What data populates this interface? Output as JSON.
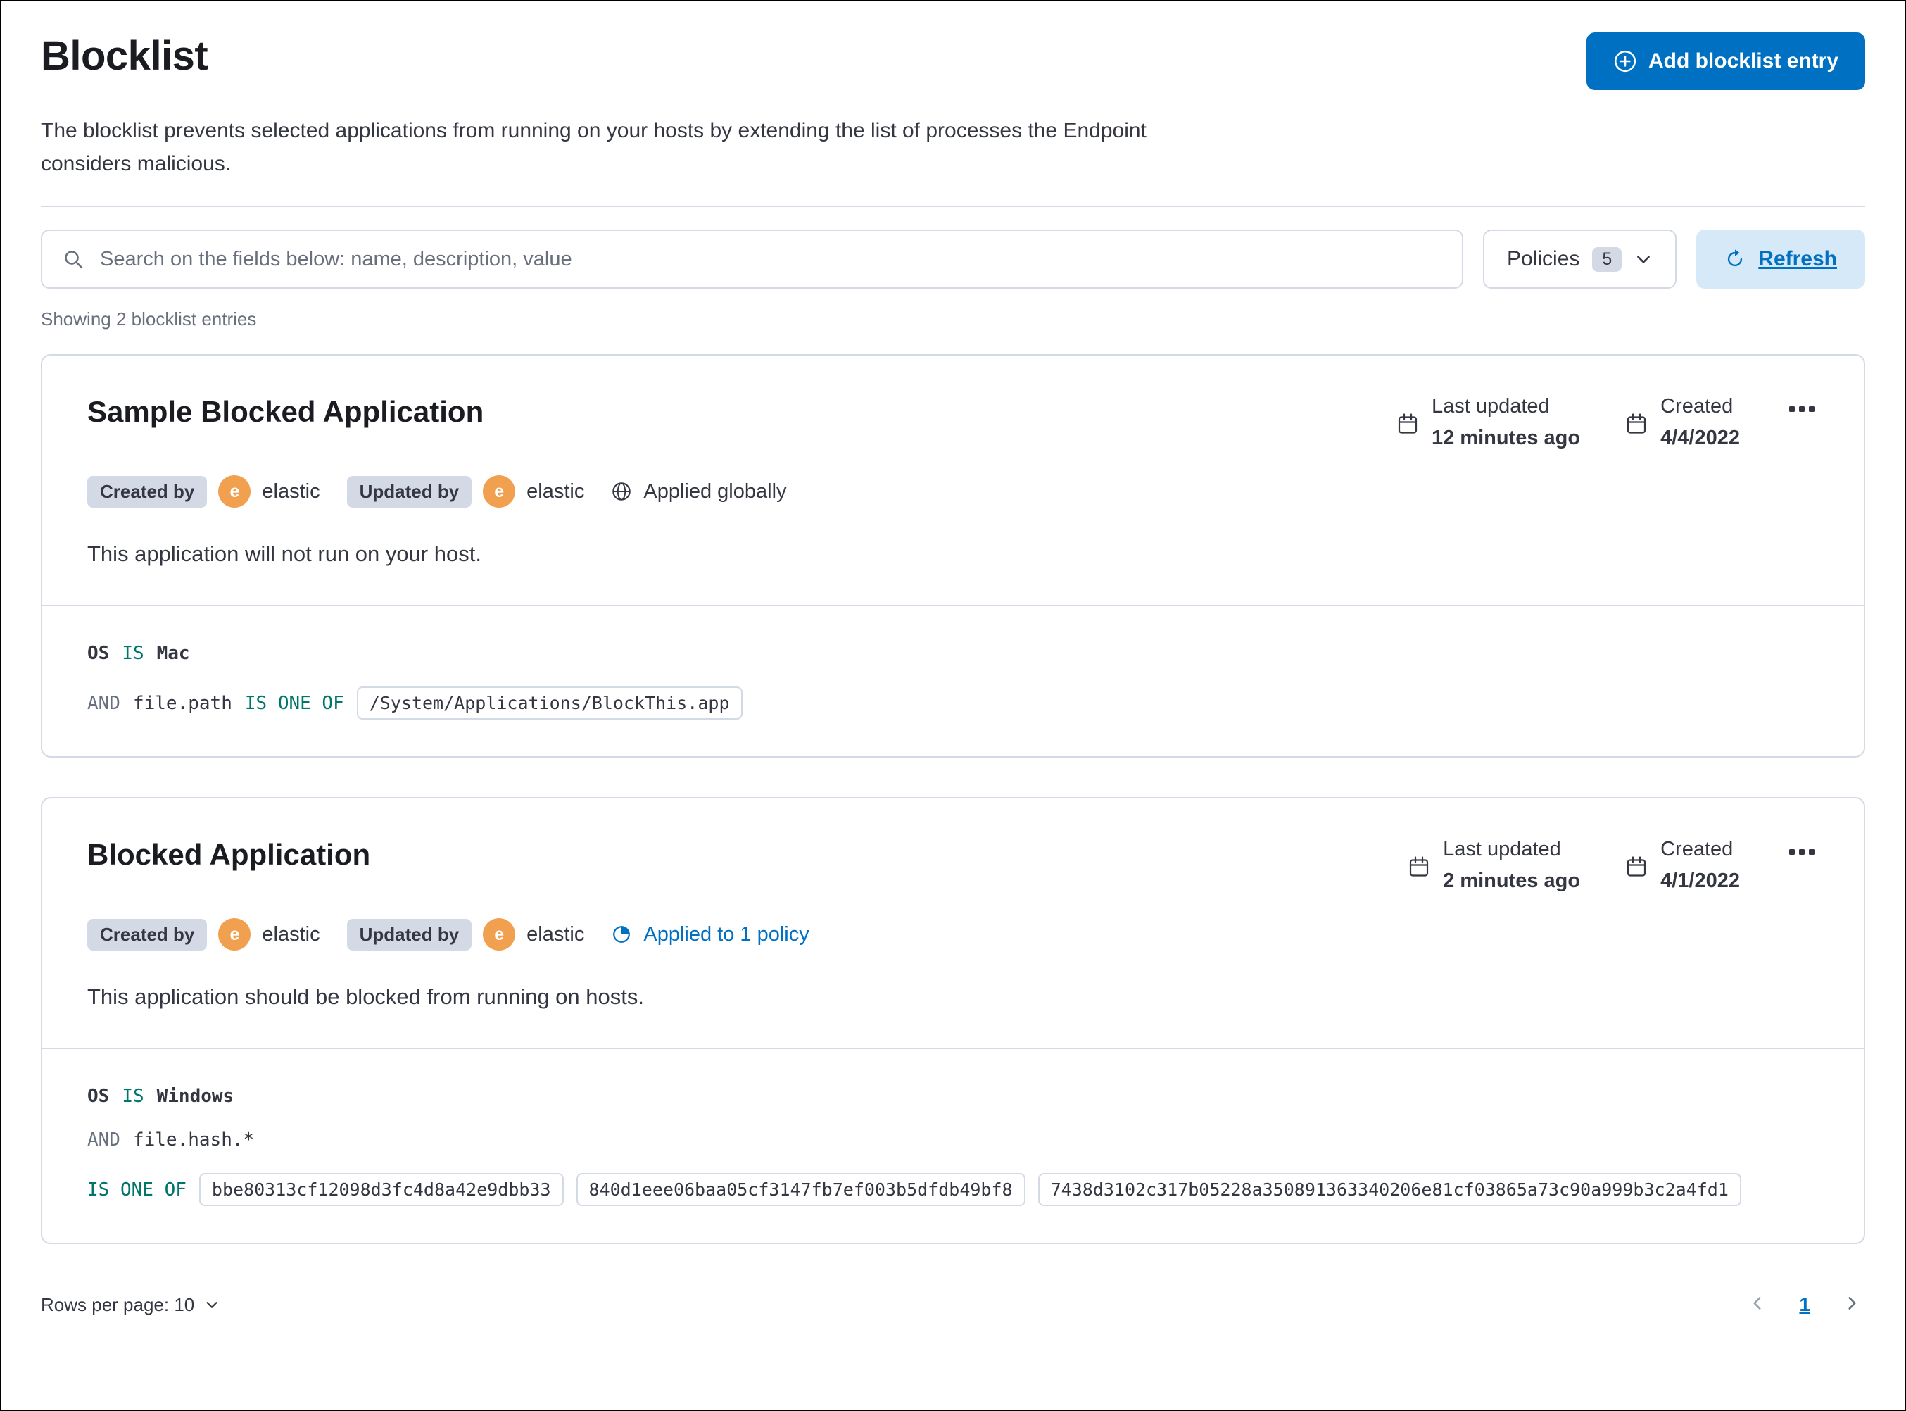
{
  "colors": {
    "primary": "#0071C2",
    "primary_light_bg": "#D6E9F8",
    "success": "#00756B",
    "badge_bg": "#D3DAE6",
    "avatar_bg": "#F1A04F",
    "border": "#D3DAE6",
    "text": "#343741",
    "subdued": "#69707D",
    "heading": "#1A1C21"
  },
  "icons": {
    "add_button": "plus-circle-icon",
    "search": "magnifier-icon",
    "policies_caret": "chevron-down-icon",
    "refresh": "refresh-icon",
    "date": "calendar-icon",
    "entry_actions": "boxes-horizontal-icon",
    "applied_globally": "globe-icon",
    "applied_policy": "partial-circle-icon",
    "rows_caret": "chevron-down-icon",
    "pagination_prev": "chevron-left-icon",
    "pagination_next": "chevron-right-icon"
  },
  "page": {
    "title": "Blocklist",
    "add_button_label": "Add blocklist entry",
    "description": "The blocklist prevents selected applications from running on your hosts by extending the list of processes the Endpoint considers malicious.",
    "showing_text": "Showing 2 blocklist entries"
  },
  "toolbar": {
    "search_placeholder": "Search on the fields below: name, description, value",
    "policies_label": "Policies",
    "policies_count": "5",
    "refresh_label": "Refresh"
  },
  "entries": [
    {
      "title": "Sample Blocked Application",
      "meta": {
        "last_updated_label": "Last updated",
        "last_updated_value": "12 minutes ago",
        "created_label": "Created",
        "created_value": "4/4/2022"
      },
      "created_by_label": "Created by",
      "created_by_name": "elastic",
      "updated_by_label": "Updated by",
      "updated_by_name": "elastic",
      "avatar_initial": "e",
      "applied": {
        "type": "global",
        "label": "Applied globally"
      },
      "description": "This application will not run on your host.",
      "criteria_lines": [
        [
          {
            "k": "field",
            "v": "OS"
          },
          {
            "k": "op",
            "v": "IS"
          },
          {
            "k": "field",
            "v": "Mac"
          }
        ],
        [
          {
            "k": "conn",
            "v": "AND"
          },
          {
            "k": "plain",
            "v": "file.path"
          },
          {
            "k": "op",
            "v": "IS ONE OF"
          },
          {
            "k": "box",
            "v": "/System/Applications/BlockThis.app"
          }
        ]
      ]
    },
    {
      "title": "Blocked Application",
      "meta": {
        "last_updated_label": "Last updated",
        "last_updated_value": "2 minutes ago",
        "created_label": "Created",
        "created_value": "4/1/2022"
      },
      "created_by_label": "Created by",
      "created_by_name": "elastic",
      "updated_by_label": "Updated by",
      "updated_by_name": "elastic",
      "avatar_initial": "e",
      "applied": {
        "type": "policy",
        "label": "Applied to 1 policy"
      },
      "description": "This application should be blocked from running on hosts.",
      "criteria_lines": [
        [
          {
            "k": "field",
            "v": "OS"
          },
          {
            "k": "op",
            "v": "IS"
          },
          {
            "k": "field",
            "v": "Windows"
          }
        ],
        [
          {
            "k": "conn",
            "v": "AND"
          },
          {
            "k": "plain",
            "v": "file.hash.*"
          }
        ],
        [
          {
            "k": "op",
            "v": "IS ONE OF"
          },
          {
            "k": "box",
            "v": "bbe80313cf12098d3fc4d8a42e9dbb33"
          },
          {
            "k": "box",
            "v": "840d1eee06baa05cf3147fb7ef003b5dfdb49bf8"
          },
          {
            "k": "box",
            "v": "7438d3102c317b05228a350891363340206e81cf03865a73c90a999b3c2a4fd1"
          }
        ]
      ]
    }
  ],
  "footer": {
    "rows_per_page_label": "Rows per page: 10",
    "current_page": "1"
  }
}
